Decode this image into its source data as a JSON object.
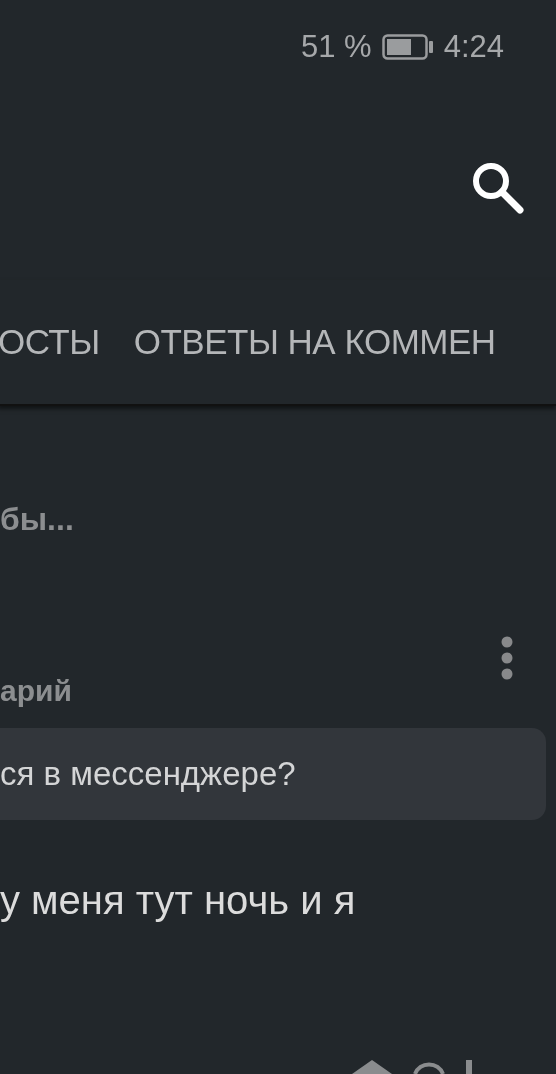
{
  "status_bar": {
    "battery": "51 %",
    "time": "4:24"
  },
  "tabs": [
    {
      "label": "ОСТЫ"
    },
    {
      "label": "ОТВЕТЫ НА КОММЕН"
    }
  ],
  "post": {
    "preview": "бы...",
    "comment_label": "арий",
    "quoted": "ся в мессенджере?",
    "reply": "у меня тут ночь и я"
  }
}
